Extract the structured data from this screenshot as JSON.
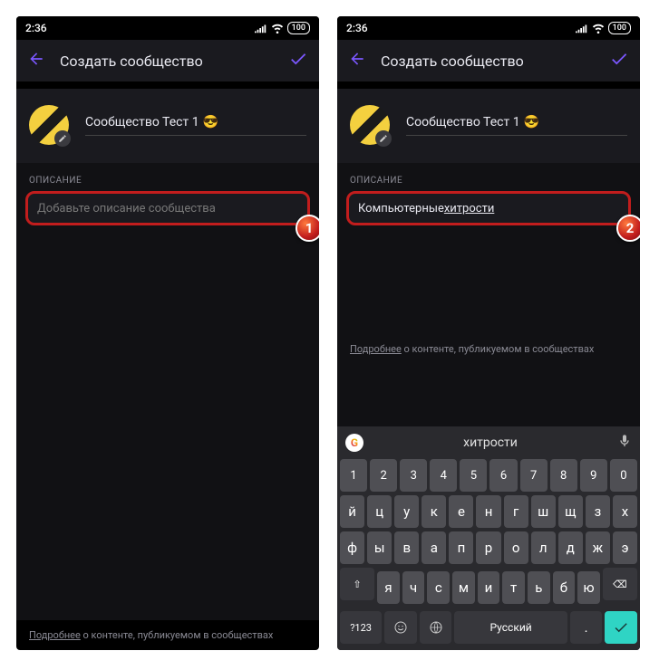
{
  "status": {
    "time": "2:36",
    "battery": "100"
  },
  "appbar": {
    "title": "Создать сообщество"
  },
  "community": {
    "name": "Сообщество Тест 1",
    "emoji": "😎"
  },
  "description": {
    "label": "ОПИСАНИЕ",
    "placeholder": "Добавьте описание сообщества",
    "value_prefix": "Компьютерные ",
    "value_underlined": "хитрости"
  },
  "more": {
    "link": "Подробнее",
    "rest": " о контенте, публикуемом в сообществах"
  },
  "badges": {
    "left": "1",
    "right": "2"
  },
  "keyboard": {
    "suggestion": "хитрости",
    "row_num": [
      "1",
      "2",
      "3",
      "4",
      "5",
      "6",
      "7",
      "8",
      "9",
      "0"
    ],
    "row1": [
      "й",
      "ц",
      "у",
      "к",
      "е",
      "н",
      "г",
      "ш",
      "щ",
      "з",
      "х"
    ],
    "row2": [
      "ф",
      "ы",
      "в",
      "а",
      "п",
      "р",
      "о",
      "л",
      "д",
      "ж",
      "э"
    ],
    "row3": [
      "я",
      "ч",
      "с",
      "м",
      "и",
      "т",
      "ь",
      "б",
      "ю"
    ],
    "shift": "⇧",
    "bksp": "⌫",
    "numkey": "?123",
    "lang": "Русский",
    "comma": ",",
    "period": "."
  }
}
